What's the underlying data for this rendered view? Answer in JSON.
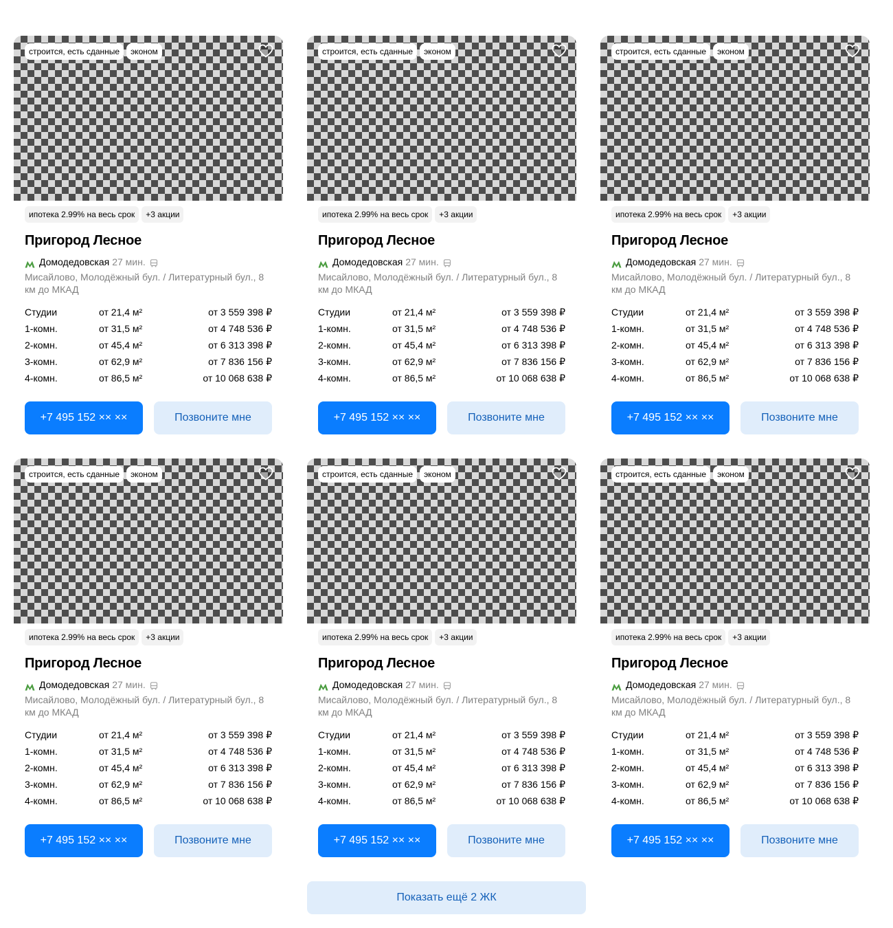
{
  "colors": {
    "accent": "#0a7dff",
    "secondary_button_bg": "#e0edfb",
    "secondary_button_text": "#1561b9",
    "metro_line": "#4a9c3f",
    "muted_text": "#808080"
  },
  "cards": [
    {
      "photo_tags": [
        "строится, есть сданные",
        "эконом"
      ],
      "favorite_icon": "heart-outline-icon",
      "promo_tags": [
        "ипотека 2.99% на весь срок",
        "+3 акции"
      ],
      "title": "Пригород Лесное",
      "metro": {
        "icon": "metro-icon",
        "station": "Домодедовская",
        "time": "27 мин.",
        "transport_icon": "bus-icon"
      },
      "address": "Мисайлово, Молодёжный бул. / Литературный бул., 8 км до МКАД",
      "rooms": [
        {
          "type": "Студии",
          "area": "от 21,4 м²",
          "price": "от 3 559 398 ₽"
        },
        {
          "type": "1-комн.",
          "area": "от 31,5 м²",
          "price": "от 4 748 536 ₽"
        },
        {
          "type": "2-комн.",
          "area": "от 45,4 м²",
          "price": "от 6 313 398 ₽"
        },
        {
          "type": "3-комн.",
          "area": "от 62,9 м²",
          "price": "от 7 836 156 ₽"
        },
        {
          "type": "4-комн.",
          "area": "от 86,5 м²",
          "price": "от 10 068 638 ₽"
        }
      ],
      "phone_button": "+7 495 152 ×× ××",
      "callback_button": "Позвоните мне"
    },
    {
      "photo_tags": [
        "строится, есть сданные",
        "эконом"
      ],
      "favorite_icon": "heart-outline-icon",
      "promo_tags": [
        "ипотека 2.99% на весь срок",
        "+3 акции"
      ],
      "title": "Пригород Лесное",
      "metro": {
        "icon": "metro-icon",
        "station": "Домодедовская",
        "time": "27 мин.",
        "transport_icon": "bus-icon"
      },
      "address": "Мисайлово, Молодёжный бул. / Литературный бул., 8 км до МКАД",
      "rooms": [
        {
          "type": "Студии",
          "area": "от 21,4 м²",
          "price": "от 3 559 398 ₽"
        },
        {
          "type": "1-комн.",
          "area": "от 31,5 м²",
          "price": "от 4 748 536 ₽"
        },
        {
          "type": "2-комн.",
          "area": "от 45,4 м²",
          "price": "от 6 313 398 ₽"
        },
        {
          "type": "3-комн.",
          "area": "от 62,9 м²",
          "price": "от 7 836 156 ₽"
        },
        {
          "type": "4-комн.",
          "area": "от 86,5 м²",
          "price": "от 10 068 638 ₽"
        }
      ],
      "phone_button": "+7 495 152 ×× ××",
      "callback_button": "Позвоните мне"
    },
    {
      "photo_tags": [
        "строится, есть сданные",
        "эконом"
      ],
      "favorite_icon": "heart-outline-icon",
      "promo_tags": [
        "ипотека 2.99% на весь срок",
        "+3 акции"
      ],
      "title": "Пригород Лесное",
      "metro": {
        "icon": "metro-icon",
        "station": "Домодедовская",
        "time": "27 мин.",
        "transport_icon": "bus-icon"
      },
      "address": "Мисайлово, Молодёжный бул. / Литературный бул., 8 км до МКАД",
      "rooms": [
        {
          "type": "Студии",
          "area": "от 21,4 м²",
          "price": "от 3 559 398 ₽"
        },
        {
          "type": "1-комн.",
          "area": "от 31,5 м²",
          "price": "от 4 748 536 ₽"
        },
        {
          "type": "2-комн.",
          "area": "от 45,4 м²",
          "price": "от 6 313 398 ₽"
        },
        {
          "type": "3-комн.",
          "area": "от 62,9 м²",
          "price": "от 7 836 156 ₽"
        },
        {
          "type": "4-комн.",
          "area": "от 86,5 м²",
          "price": "от 10 068 638 ₽"
        }
      ],
      "phone_button": "+7 495 152 ×× ××",
      "callback_button": "Позвоните мне"
    },
    {
      "photo_tags": [
        "строится, есть сданные",
        "эконом"
      ],
      "favorite_icon": "heart-outline-icon",
      "promo_tags": [
        "ипотека 2.99% на весь срок",
        "+3 акции"
      ],
      "title": "Пригород Лесное",
      "metro": {
        "icon": "metro-icon",
        "station": "Домодедовская",
        "time": "27 мин.",
        "transport_icon": "bus-icon"
      },
      "address": "Мисайлово, Молодёжный бул. / Литературный бул., 8 км до МКАД",
      "rooms": [
        {
          "type": "Студии",
          "area": "от 21,4 м²",
          "price": "от 3 559 398 ₽"
        },
        {
          "type": "1-комн.",
          "area": "от 31,5 м²",
          "price": "от 4 748 536 ₽"
        },
        {
          "type": "2-комн.",
          "area": "от 45,4 м²",
          "price": "от 6 313 398 ₽"
        },
        {
          "type": "3-комн.",
          "area": "от 62,9 м²",
          "price": "от 7 836 156 ₽"
        },
        {
          "type": "4-комн.",
          "area": "от 86,5 м²",
          "price": "от 10 068 638 ₽"
        }
      ],
      "phone_button": "+7 495 152 ×× ××",
      "callback_button": "Позвоните мне"
    },
    {
      "photo_tags": [
        "строится, есть сданные",
        "эконом"
      ],
      "favorite_icon": "heart-outline-icon",
      "promo_tags": [
        "ипотека 2.99% на весь срок",
        "+3 акции"
      ],
      "title": "Пригород Лесное",
      "metro": {
        "icon": "metro-icon",
        "station": "Домодедовская",
        "time": "27 мин.",
        "transport_icon": "bus-icon"
      },
      "address": "Мисайлово, Молодёжный бул. / Литературный бул., 8 км до МКАД",
      "rooms": [
        {
          "type": "Студии",
          "area": "от 21,4 м²",
          "price": "от 3 559 398 ₽"
        },
        {
          "type": "1-комн.",
          "area": "от 31,5 м²",
          "price": "от 4 748 536 ₽"
        },
        {
          "type": "2-комн.",
          "area": "от 45,4 м²",
          "price": "от 6 313 398 ₽"
        },
        {
          "type": "3-комн.",
          "area": "от 62,9 м²",
          "price": "от 7 836 156 ₽"
        },
        {
          "type": "4-комн.",
          "area": "от 86,5 м²",
          "price": "от 10 068 638 ₽"
        }
      ],
      "phone_button": "+7 495 152 ×× ××",
      "callback_button": "Позвоните мне"
    },
    {
      "photo_tags": [
        "строится, есть сданные",
        "эконом"
      ],
      "favorite_icon": "heart-outline-icon",
      "promo_tags": [
        "ипотека 2.99% на весь срок",
        "+3 акции"
      ],
      "title": "Пригород Лесное",
      "metro": {
        "icon": "metro-icon",
        "station": "Домодедовская",
        "time": "27 мин.",
        "transport_icon": "bus-icon"
      },
      "address": "Мисайлово, Молодёжный бул. / Литературный бул., 8 км до МКАД",
      "rooms": [
        {
          "type": "Студии",
          "area": "от 21,4 м²",
          "price": "от 3 559 398 ₽"
        },
        {
          "type": "1-комн.",
          "area": "от 31,5 м²",
          "price": "от 4 748 536 ₽"
        },
        {
          "type": "2-комн.",
          "area": "от 45,4 м²",
          "price": "от 6 313 398 ₽"
        },
        {
          "type": "3-комн.",
          "area": "от 62,9 м²",
          "price": "от 7 836 156 ₽"
        },
        {
          "type": "4-комн.",
          "area": "от 86,5 м²",
          "price": "от 10 068 638 ₽"
        }
      ],
      "phone_button": "+7 495 152 ×× ××",
      "callback_button": "Позвоните мне"
    }
  ],
  "show_more_button": "Показать ещё 2 ЖК"
}
